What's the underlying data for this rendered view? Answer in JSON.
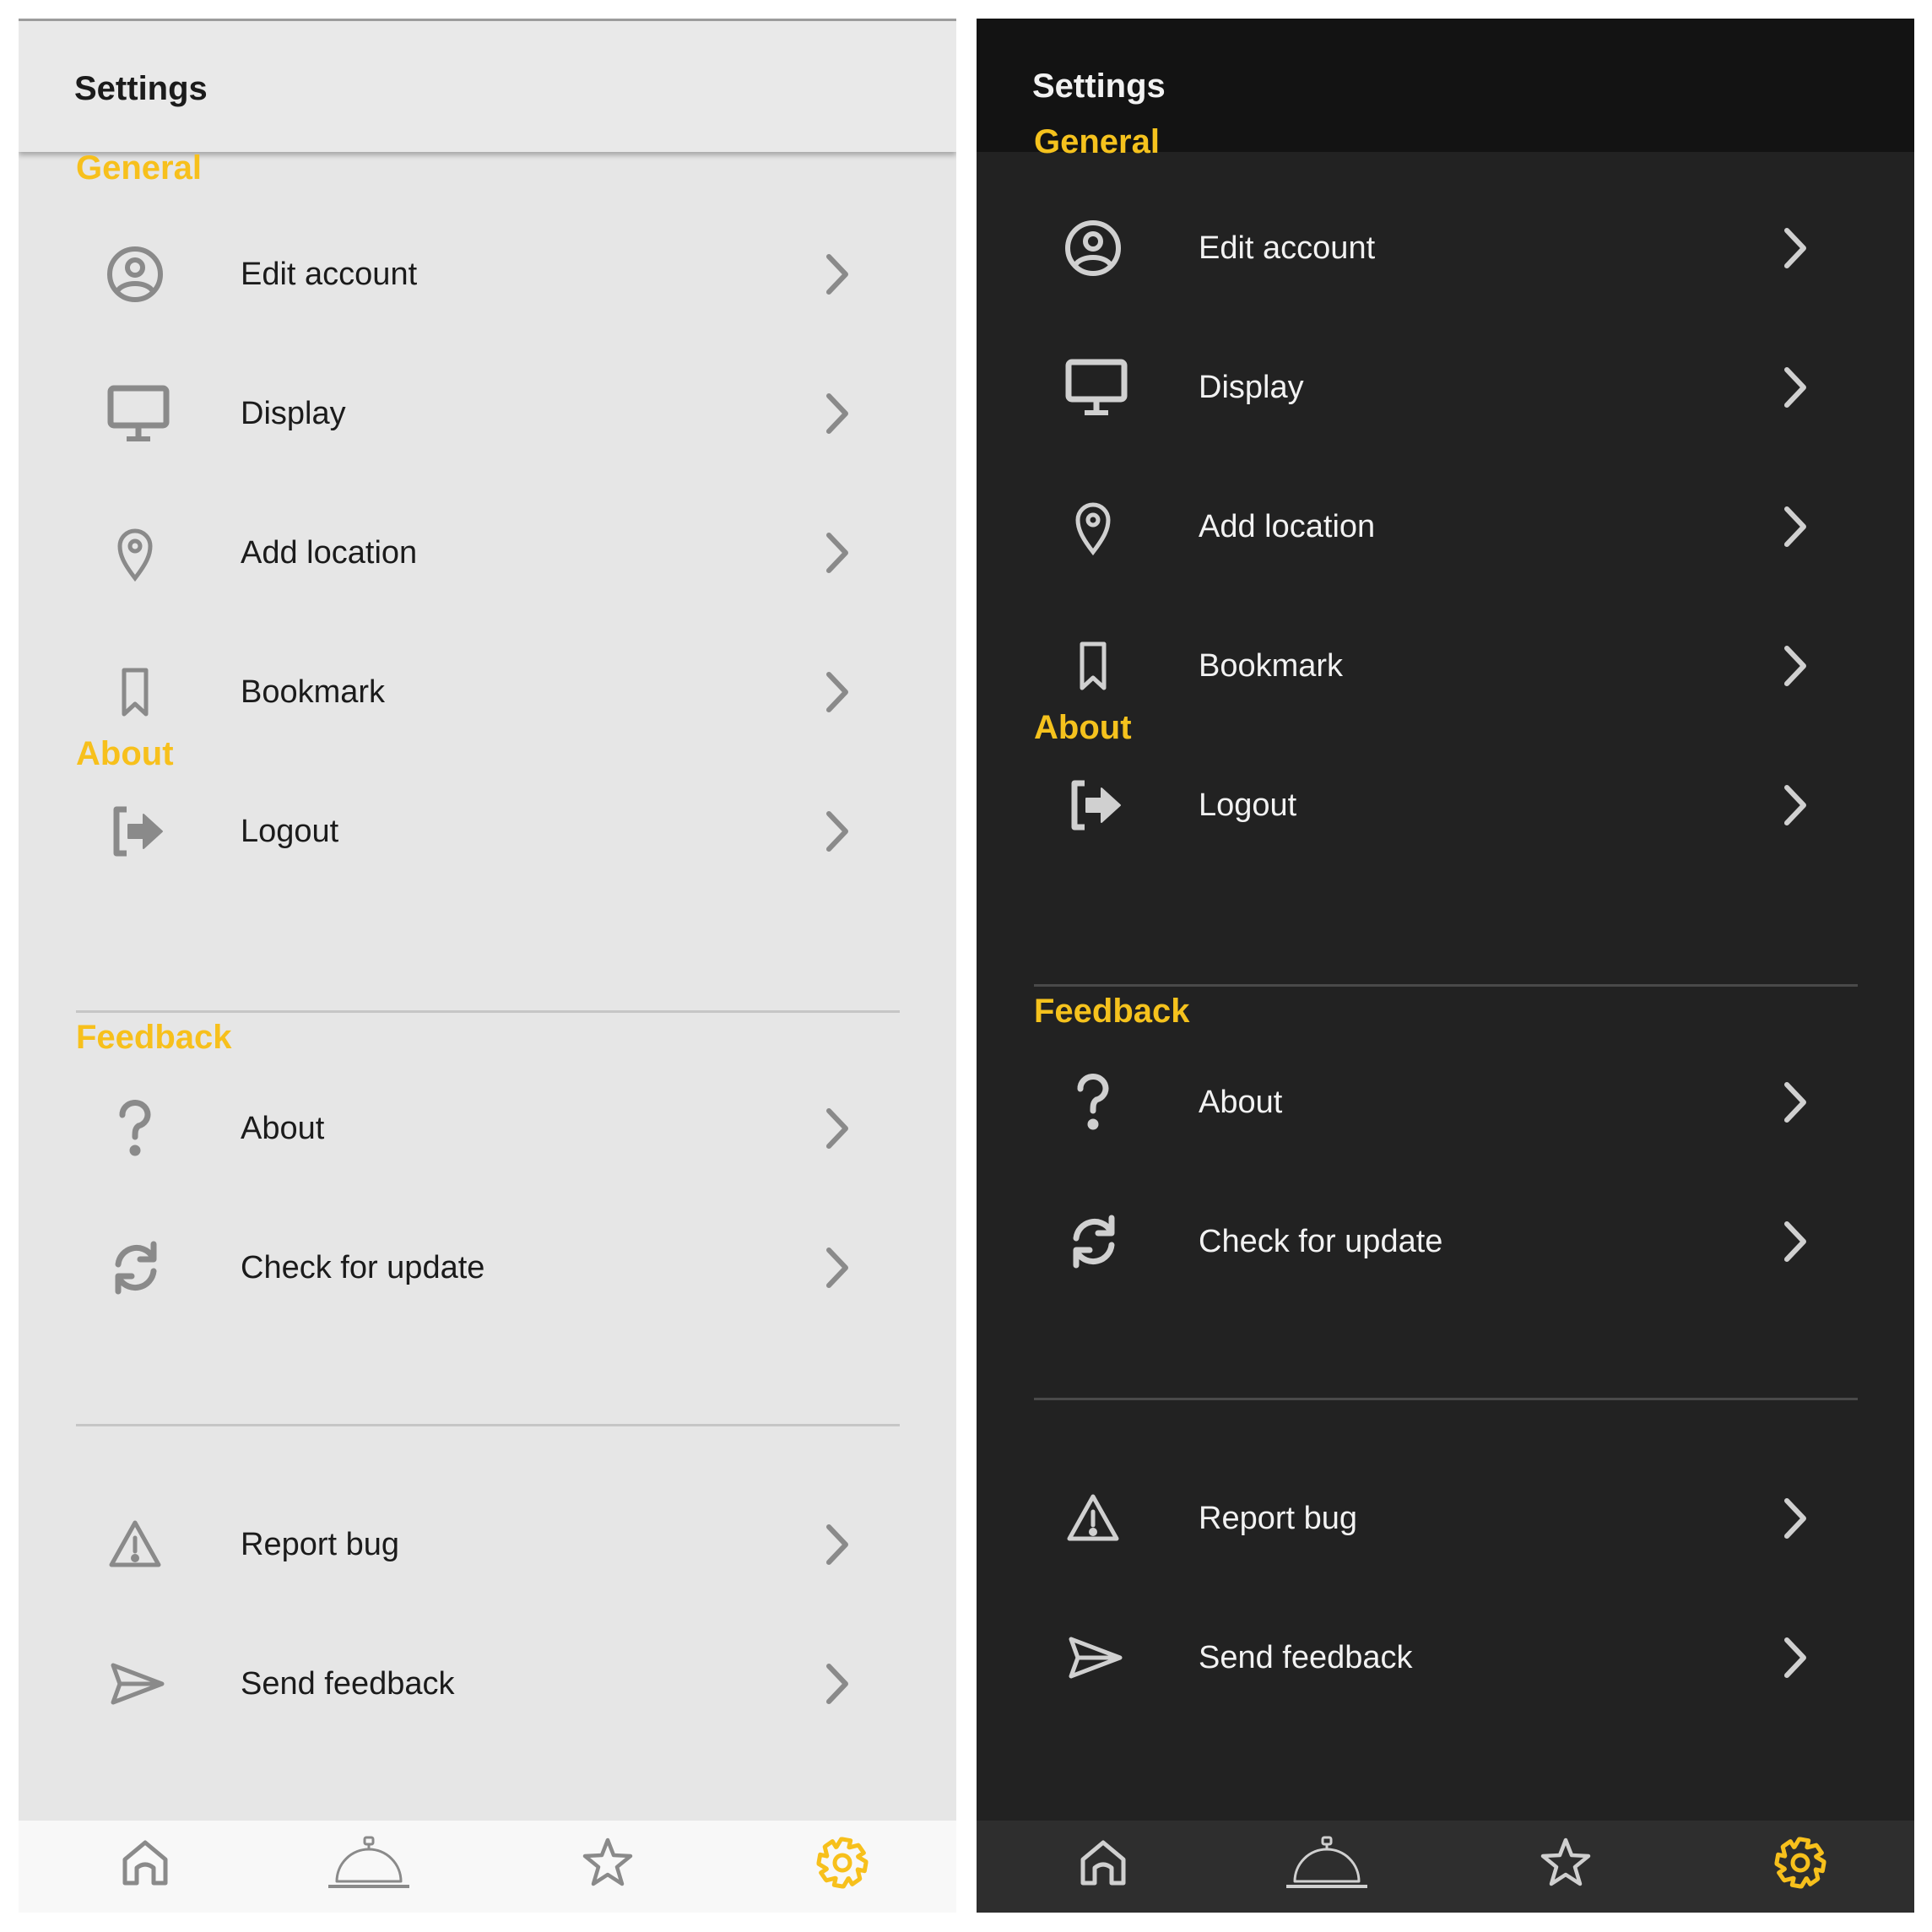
{
  "colors": {
    "accent": "#f7c01c",
    "light_background": "#e6e6e6",
    "light_icon": "#8a8a8a",
    "dark_background": "#222222",
    "dark_icon": "#d0d0d0"
  },
  "app_bar": {
    "title": "Settings"
  },
  "sections": {
    "general": {
      "title": "General",
      "items": [
        {
          "label": "Edit account",
          "icon": "account-circle-icon"
        },
        {
          "label": "Display",
          "icon": "monitor-icon"
        },
        {
          "label": "Add location",
          "icon": "location-pin-icon"
        },
        {
          "label": "Bookmark",
          "icon": "bookmark-icon"
        },
        {
          "label": "Logout",
          "icon": "logout-icon"
        }
      ]
    },
    "about": {
      "title": "About",
      "items": [
        {
          "label": "About",
          "icon": "question-mark-icon"
        },
        {
          "label": "Check for update",
          "icon": "refresh-icon"
        }
      ]
    },
    "feedback": {
      "title": "Feedback",
      "items": [
        {
          "label": "Report bug",
          "icon": "warning-icon"
        },
        {
          "label": "Send feedback",
          "icon": "send-icon"
        }
      ]
    }
  },
  "bottom_nav": {
    "items": [
      {
        "icon": "home-icon",
        "active": false
      },
      {
        "icon": "cloche-icon",
        "active": false
      },
      {
        "icon": "star-icon",
        "active": false
      },
      {
        "icon": "gear-icon",
        "active": true
      }
    ]
  }
}
